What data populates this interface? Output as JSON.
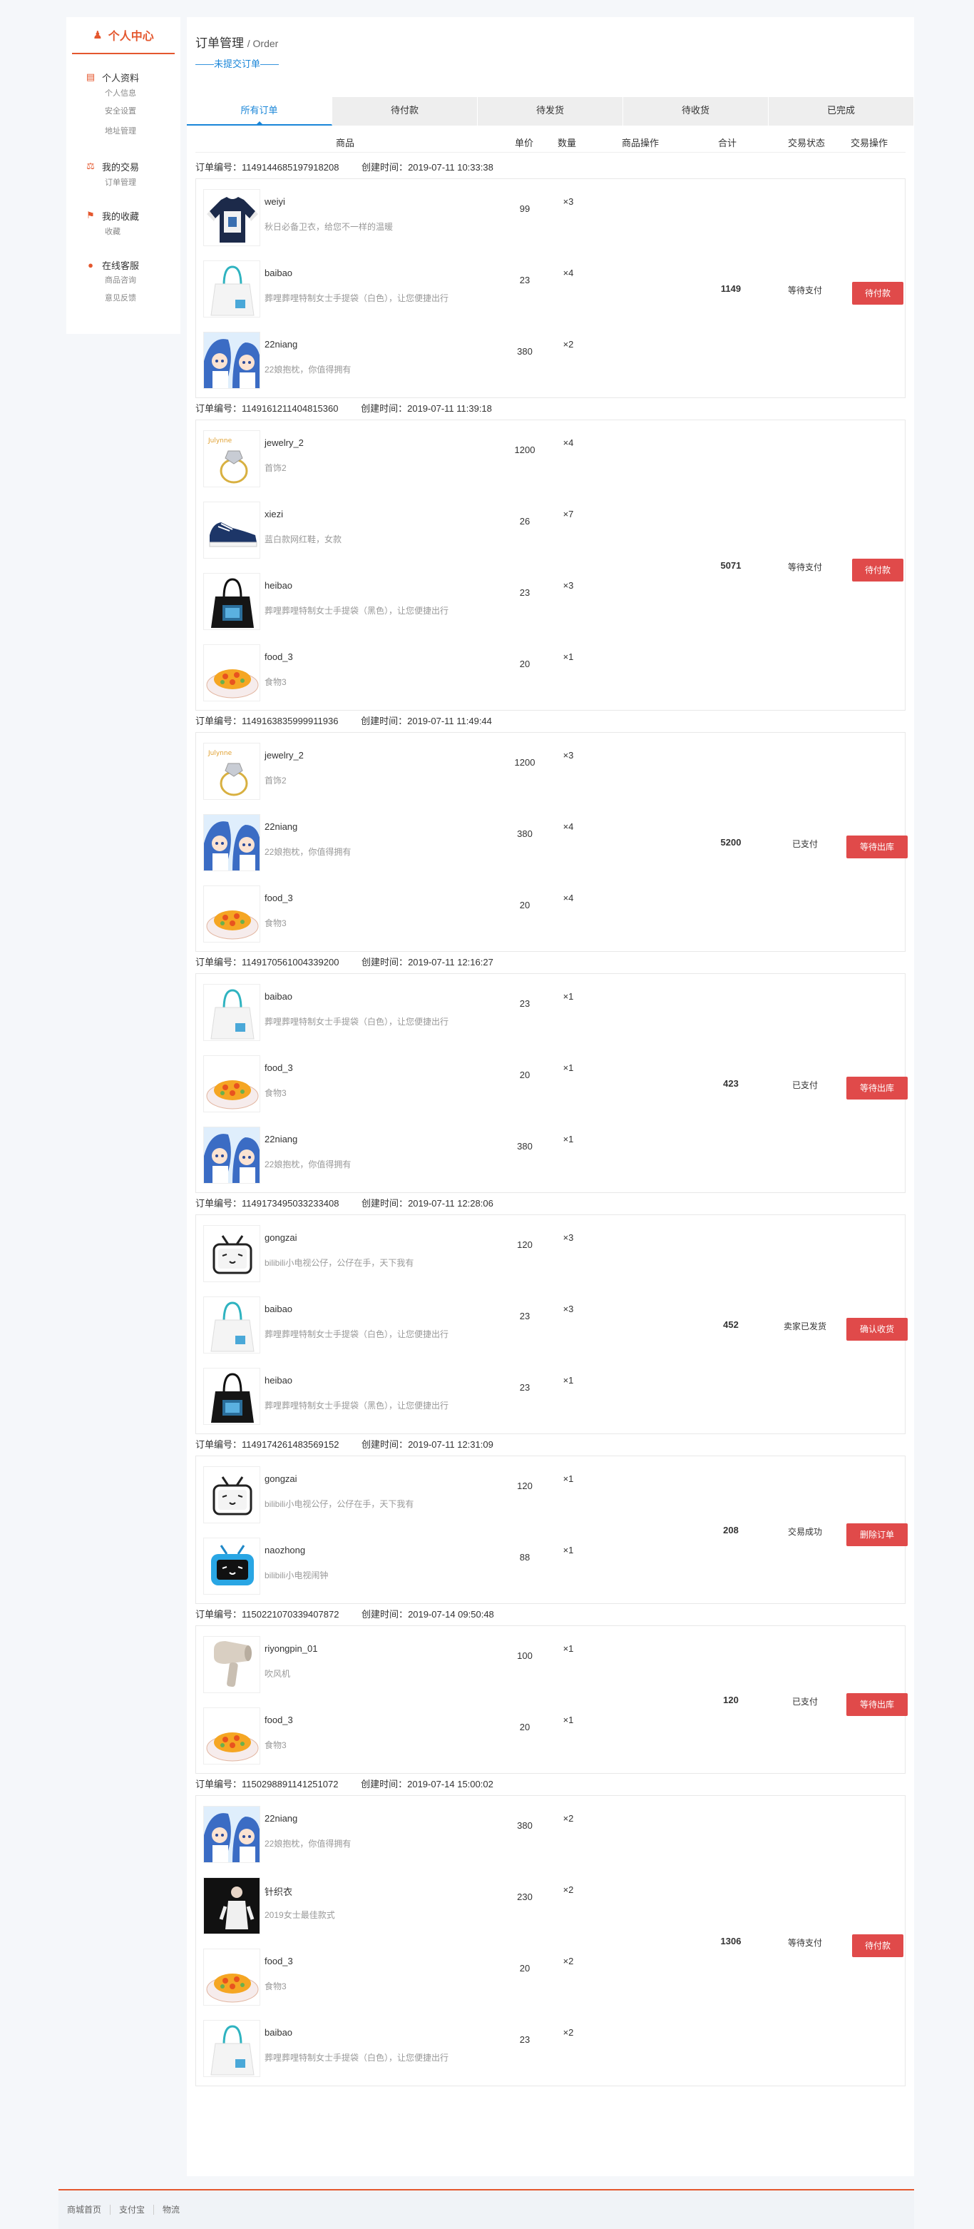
{
  "sidebar": {
    "title": "个人中心",
    "sections": [
      {
        "title": "个人资料",
        "items": [
          "个人信息",
          "安全设置",
          "地址管理"
        ]
      },
      {
        "title": "我的交易",
        "items": [
          "订单管理"
        ]
      },
      {
        "title": "我的收藏",
        "items": [
          "收藏"
        ]
      },
      {
        "title": "在线客服",
        "items": [
          "商品咨询",
          "意见反馈"
        ]
      }
    ]
  },
  "header": {
    "title": "订单管理",
    "subtitle": "/ Order",
    "link": "——未提交订单——"
  },
  "tabs": [
    "所有订单",
    "待付款",
    "待发货",
    "待收货",
    "已完成"
  ],
  "table_headers": [
    "商品",
    "单价",
    "数量",
    "商品操作",
    "合计",
    "交易状态",
    "交易操作"
  ],
  "labels": {
    "order_no": "订单编号：",
    "created": "创建时间："
  },
  "orders": [
    {
      "id": "1149144685197918208",
      "created": "2019-07-11 10:33:38",
      "total": "1149",
      "status": "等待支付",
      "action": "待付款",
      "items": [
        {
          "name": "weiyi",
          "desc": "秋日必备卫衣，给您不一样的温暖",
          "price": "99",
          "qty": "×3",
          "img": "sweater"
        },
        {
          "name": "baibao",
          "desc": "葬哩葬哩特制女士手提袋（白色），让您便捷出行",
          "price": "23",
          "qty": "×4",
          "img": "bag-white"
        },
        {
          "name": "22niang",
          "desc": "22娘抱枕，你值得拥有",
          "price": "380",
          "qty": "×2",
          "img": "anime"
        }
      ]
    },
    {
      "id": "1149161211404815360",
      "created": "2019-07-11 11:39:18",
      "total": "5071",
      "status": "等待支付",
      "action": "待付款",
      "items": [
        {
          "name": "jewelry_2",
          "desc": "首饰2",
          "price": "1200",
          "qty": "×4",
          "img": "ring"
        },
        {
          "name": "xiezi",
          "desc": "蓝白款网红鞋，女款",
          "price": "26",
          "qty": "×7",
          "img": "shoe"
        },
        {
          "name": "heibao",
          "desc": "葬哩葬哩特制女士手提袋（黑色），让您便捷出行",
          "price": "23",
          "qty": "×3",
          "img": "bag-black"
        },
        {
          "name": "food_3",
          "desc": "食物3",
          "price": "20",
          "qty": "×1",
          "img": "food"
        }
      ]
    },
    {
      "id": "1149163835999911936",
      "created": "2019-07-11 11:49:44",
      "total": "5200",
      "status": "已支付",
      "action": "等待出库",
      "items": [
        {
          "name": "jewelry_2",
          "desc": "首饰2",
          "price": "1200",
          "qty": "×3",
          "img": "ring"
        },
        {
          "name": "22niang",
          "desc": "22娘抱枕，你值得拥有",
          "price": "380",
          "qty": "×4",
          "img": "anime"
        },
        {
          "name": "food_3",
          "desc": "食物3",
          "price": "20",
          "qty": "×4",
          "img": "food"
        }
      ]
    },
    {
      "id": "1149170561004339200",
      "created": "2019-07-11 12:16:27",
      "total": "423",
      "status": "已支付",
      "action": "等待出库",
      "items": [
        {
          "name": "baibao",
          "desc": "葬哩葬哩特制女士手提袋（白色），让您便捷出行",
          "price": "23",
          "qty": "×1",
          "img": "bag-white"
        },
        {
          "name": "food_3",
          "desc": "食物3",
          "price": "20",
          "qty": "×1",
          "img": "food"
        },
        {
          "name": "22niang",
          "desc": "22娘抱枕，你值得拥有",
          "price": "380",
          "qty": "×1",
          "img": "anime"
        }
      ]
    },
    {
      "id": "1149173495033233408",
      "created": "2019-07-11 12:28:06",
      "total": "452",
      "status": "卖家已发货",
      "action": "确认收货",
      "items": [
        {
          "name": "gongzai",
          "desc": "bilibili小电视公仔，公仔在手，天下我有",
          "price": "120",
          "qty": "×3",
          "img": "tv"
        },
        {
          "name": "baibao",
          "desc": "葬哩葬哩特制女士手提袋（白色），让您便捷出行",
          "price": "23",
          "qty": "×3",
          "img": "bag-white"
        },
        {
          "name": "heibao",
          "desc": "葬哩葬哩特制女士手提袋（黑色），让您便捷出行",
          "price": "23",
          "qty": "×1",
          "img": "bag-black"
        }
      ]
    },
    {
      "id": "1149174261483569152",
      "created": "2019-07-11 12:31:09",
      "total": "208",
      "status": "交易成功",
      "action": "删除订单",
      "items": [
        {
          "name": "gongzai",
          "desc": "bilibili小电视公仔，公仔在手，天下我有",
          "price": "120",
          "qty": "×1",
          "img": "tv"
        },
        {
          "name": "naozhong",
          "desc": "bilibili小电视闹钟",
          "price": "88",
          "qty": "×1",
          "img": "clock"
        }
      ]
    },
    {
      "id": "1150221070339407872",
      "created": "2019-07-14 09:50:48",
      "total": "120",
      "status": "已支付",
      "action": "等待出库",
      "items": [
        {
          "name": "riyongpin_01",
          "desc": "吹风机",
          "price": "100",
          "qty": "×1",
          "img": "dryer"
        },
        {
          "name": "food_3",
          "desc": "食物3",
          "price": "20",
          "qty": "×1",
          "img": "food"
        }
      ]
    },
    {
      "id": "1150298891141251072",
      "created": "2019-07-14 15:00:02",
      "total": "1306",
      "status": "等待支付",
      "action": "待付款",
      "items": [
        {
          "name": "22niang",
          "desc": "22娘抱枕，你值得拥有",
          "price": "380",
          "qty": "×2",
          "img": "anime"
        },
        {
          "name": "针织衣",
          "desc": "2019女士最佳款式",
          "price": "230",
          "qty": "×2",
          "img": "knit"
        },
        {
          "name": "food_3",
          "desc": "食物3",
          "price": "20",
          "qty": "×2",
          "img": "food"
        },
        {
          "name": "baibao",
          "desc": "葬哩葬哩特制女士手提袋（白色），让您便捷出行",
          "price": "23",
          "qty": "×2",
          "img": "bag-white"
        }
      ]
    }
  ],
  "footer": [
    "商城首页",
    "支付宝",
    "物流"
  ],
  "colors": {
    "accent": "#e4572e",
    "link": "#1a86d8",
    "button": "#e04a4a"
  }
}
